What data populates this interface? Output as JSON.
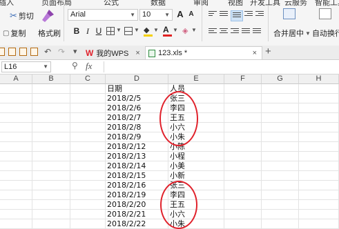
{
  "ribbon": {
    "tabs": [
      "插入",
      "页面布局",
      "公式",
      "数据",
      "审阅",
      "视图",
      "开发工具",
      "云服务",
      "智能工具"
    ],
    "cut_label": "剪切",
    "copy_label": "复制",
    "format_painter_label": "格式刷",
    "font_name": "Arial",
    "font_size": "10",
    "grow_font": "A",
    "shrink_font": "A",
    "bold": "B",
    "italic": "I",
    "underline": "U",
    "font_color_glyph": "A",
    "merge_center_label": "合并居中",
    "wrap_text_label": "自动换行",
    "font_color_hex": "#e02020",
    "fill_color_hex": "#f5d000"
  },
  "tabbar": {
    "add_tab": "+",
    "tabs": [
      {
        "label": "我的WPS",
        "close": "×"
      },
      {
        "label": "123.xls *",
        "close": "×"
      }
    ]
  },
  "formula_bar": {
    "cell_ref": "L16",
    "fx": "fx"
  },
  "sheet": {
    "columns": [
      "A",
      "B",
      "C",
      "D",
      "E",
      "F",
      "G",
      "H"
    ],
    "rows": [
      {
        "date": "日期",
        "name": "人员"
      },
      {
        "date": "2018/2/5",
        "name": "张三"
      },
      {
        "date": "2018/2/6",
        "name": "李四"
      },
      {
        "date": "2018/2/7",
        "name": "王五"
      },
      {
        "date": "2018/2/8",
        "name": "小六"
      },
      {
        "date": "2018/2/9",
        "name": "小朱"
      },
      {
        "date": "2018/2/12",
        "name": "小陈"
      },
      {
        "date": "2018/2/13",
        "name": "小程"
      },
      {
        "date": "2018/2/14",
        "name": "小美"
      },
      {
        "date": "2018/2/15",
        "name": "小新"
      },
      {
        "date": "2018/2/16",
        "name": "张三"
      },
      {
        "date": "2018/2/19",
        "name": "李四"
      },
      {
        "date": "2018/2/20",
        "name": "王五"
      },
      {
        "date": "2018/2/21",
        "name": "小六"
      },
      {
        "date": "2018/2/22",
        "name": "小朱"
      }
    ]
  },
  "annotation": {
    "color": "#e0212b"
  }
}
